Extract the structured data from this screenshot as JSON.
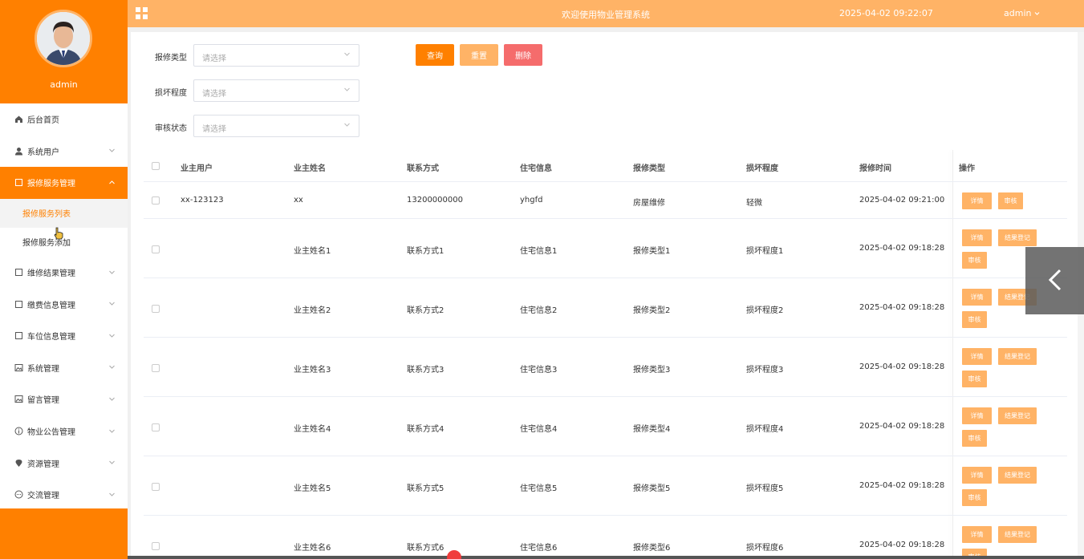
{
  "app": {
    "title": "欢迎使用物业管理系统",
    "time": "2025-04-02 09:22:07",
    "user": "admin"
  },
  "sidebar": {
    "username": "admin",
    "items": [
      {
        "label": "后台首页",
        "icon": "home-icon"
      },
      {
        "label": "系统用户",
        "icon": "user-icon"
      },
      {
        "label": "报修服务管理",
        "icon": "document-icon",
        "active": true,
        "children": [
          {
            "label": "报修服务列表",
            "active": true
          },
          {
            "label": "报修服务添加"
          }
        ]
      },
      {
        "label": "维修结果管理",
        "icon": "document-icon"
      },
      {
        "label": "缴费信息管理",
        "icon": "document-icon"
      },
      {
        "label": "车位信息管理",
        "icon": "document-icon"
      },
      {
        "label": "系统管理",
        "icon": "picture-icon"
      },
      {
        "label": "留言管理",
        "icon": "picture-icon"
      },
      {
        "label": "物业公告管理",
        "icon": "info-icon"
      },
      {
        "label": "资源管理",
        "icon": "location-icon"
      },
      {
        "label": "交流管理",
        "icon": "chat-icon"
      }
    ]
  },
  "filters": {
    "repair_type": {
      "label": "报修类型",
      "placeholder": "请选择"
    },
    "damage_level": {
      "label": "损坏程度",
      "placeholder": "请选择"
    },
    "review_status": {
      "label": "审核状态",
      "placeholder": "请选择"
    },
    "query": "查询",
    "reset": "重置",
    "delete": "删除"
  },
  "table": {
    "headers": [
      "业主用户",
      "业主姓名",
      "联系方式",
      "住宅信息",
      "报修类型",
      "损坏程度",
      "报修时间",
      "操作"
    ],
    "rows": [
      {
        "user": "xx-123123",
        "name": "xx",
        "contact": "13200000000",
        "house": "yhgfd",
        "type": "房屋维修",
        "level": "轻微",
        "time": "2025-04-02 09:21:00",
        "actions": [
          "详情",
          "审核"
        ]
      },
      {
        "user": "",
        "name": "业主姓名1",
        "contact": "联系方式1",
        "house": "住宅信息1",
        "type": "报修类型1",
        "level": "损坏程度1",
        "time": "2025-04-02 09:18:28",
        "actions": [
          "详情",
          "结果登记",
          "审核"
        ]
      },
      {
        "user": "",
        "name": "业主姓名2",
        "contact": "联系方式2",
        "house": "住宅信息2",
        "type": "报修类型2",
        "level": "损坏程度2",
        "time": "2025-04-02 09:18:28",
        "actions": [
          "详情",
          "结果登记",
          "审核"
        ]
      },
      {
        "user": "",
        "name": "业主姓名3",
        "contact": "联系方式3",
        "house": "住宅信息3",
        "type": "报修类型3",
        "level": "损坏程度3",
        "time": "2025-04-02 09:18:28",
        "actions": [
          "详情",
          "结果登记",
          "审核"
        ]
      },
      {
        "user": "",
        "name": "业主姓名4",
        "contact": "联系方式4",
        "house": "住宅信息4",
        "type": "报修类型4",
        "level": "损坏程度4",
        "time": "2025-04-02 09:18:28",
        "actions": [
          "详情",
          "结果登记",
          "审核"
        ]
      },
      {
        "user": "",
        "name": "业主姓名5",
        "contact": "联系方式5",
        "house": "住宅信息5",
        "type": "报修类型5",
        "level": "损坏程度5",
        "time": "2025-04-02 09:18:28",
        "actions": [
          "详情",
          "结果登记",
          "审核"
        ]
      },
      {
        "user": "",
        "name": "业主姓名6",
        "contact": "联系方式6",
        "house": "住宅信息6",
        "type": "报修类型6",
        "level": "损坏程度6",
        "time": "2025-04-02 09:18:28",
        "actions": [
          "详情",
          "结果登记",
          "审核"
        ]
      }
    ]
  },
  "colors": {
    "primary": "#ff8000",
    "light": "#ffb366",
    "danger": "#f56c6c"
  }
}
